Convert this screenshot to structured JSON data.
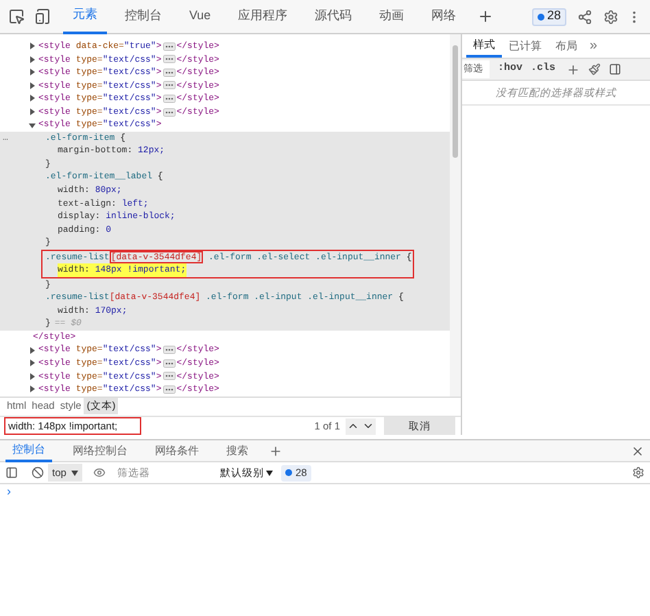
{
  "toolbar": {
    "tabs": [
      {
        "label": "元素",
        "selected": true
      },
      {
        "label": "控制台",
        "selected": false
      },
      {
        "label": "Vue",
        "selected": false
      },
      {
        "label": "应用程序",
        "selected": false
      },
      {
        "label": "源代码",
        "selected": false
      },
      {
        "label": "动画",
        "selected": false
      },
      {
        "label": "网络",
        "selected": false
      }
    ],
    "issues_badge": "28"
  },
  "elements": [
    {
      "expanded": false,
      "tag_open": "<style",
      "attr": "data-cke=",
      "value": "\"true\"",
      "tag_end": ">",
      "close": "</style>"
    },
    {
      "expanded": false,
      "tag_open": "<style",
      "attr": "type=",
      "value": "\"text/css\"",
      "tag_end": ">",
      "close": "</style>"
    },
    {
      "expanded": false,
      "tag_open": "<style",
      "attr": "type=",
      "value": "\"text/css\"",
      "tag_end": ">",
      "close": "</style>"
    },
    {
      "expanded": false,
      "tag_open": "<style",
      "attr": "type=",
      "value": "\"text/css\"",
      "tag_end": ">",
      "close": "</style>"
    },
    {
      "expanded": false,
      "tag_open": "<style",
      "attr": "type=",
      "value": "\"text/css\"",
      "tag_end": ">",
      "close": "</style>"
    },
    {
      "expanded": false,
      "tag_open": "<style",
      "attr": "type=",
      "value": "\"text/css\"",
      "tag_end": ">",
      "close": "</style>"
    },
    {
      "expanded": true,
      "tag_open": "<style",
      "attr": "type=",
      "value": "\"text/css\"",
      "tag_end": ">",
      "close": "</style>",
      "children": [
        {
          "selected": true,
          "marker": "…",
          "rules": [
            {
              "boxed": false,
              "selector": [
                {
                  "text": ".el-form-item",
                  "boxed": false,
                  "kind": "class"
                }
              ],
              "open": "{",
              "close": "}",
              "declarations": [
                {
                  "prop": "margin-bottom:",
                  "value": "12px;",
                  "highlighted": false
                }
              ]
            },
            {
              "boxed": false,
              "selector": [
                {
                  "text": ".el-form-item__label",
                  "boxed": false,
                  "kind": "class"
                }
              ],
              "open": "{",
              "close": "}",
              "declarations": [
                {
                  "prop": "width:",
                  "value": "80px;",
                  "highlighted": false
                },
                {
                  "prop": "text-align:",
                  "value": "left;",
                  "highlighted": false
                },
                {
                  "prop": "display:",
                  "value": "inline-block;",
                  "highlighted": false
                },
                {
                  "prop": "padding:",
                  "value": "0",
                  "highlighted": false
                }
              ]
            },
            {
              "boxed": true,
              "selector": [
                {
                  "text": ".resume-list",
                  "boxed": false,
                  "kind": "class"
                },
                {
                  "text": "[data-v-3544dfe4]",
                  "boxed": true,
                  "kind": "attr"
                },
                {
                  "text": " .el-form .el-select .el-input__inner",
                  "boxed": false,
                  "kind": "class"
                }
              ],
              "open": "{",
              "close": "}",
              "declarations": [
                {
                  "prop": "width:",
                  "value": "148px !important;",
                  "highlighted": true
                }
              ]
            },
            {
              "boxed": false,
              "selector": [
                {
                  "text": ".resume-list",
                  "boxed": false,
                  "kind": "class"
                },
                {
                  "text": "[data-v-3544dfe4]",
                  "boxed": false,
                  "kind": "attr"
                },
                {
                  "text": " .el-form .el-input .el-input__inner",
                  "boxed": false,
                  "kind": "class"
                }
              ],
              "open": "{",
              "close": "}",
              "suffix": "== $0",
              "declarations": [
                {
                  "prop": "width:",
                  "value": "170px;",
                  "highlighted": false
                }
              ]
            }
          ]
        }
      ]
    },
    {
      "expanded": false,
      "tag_open": "<style",
      "attr": "type=",
      "value": "\"text/css\"",
      "tag_end": ">",
      "close": "</style>"
    },
    {
      "expanded": false,
      "tag_open": "<style",
      "attr": "type=",
      "value": "\"text/css\"",
      "tag_end": ">",
      "close": "</style>"
    },
    {
      "expanded": false,
      "tag_open": "<style",
      "attr": "type=",
      "value": "\"text/css\"",
      "tag_end": ">",
      "close": "</style>"
    },
    {
      "expanded": false,
      "tag_open": "<style",
      "attr": "type=",
      "value": "\"text/css\"",
      "tag_end": ">",
      "close": "</style>"
    }
  ],
  "breadcrumbs": [
    {
      "label": "html",
      "selected": false
    },
    {
      "label": "head",
      "selected": false
    },
    {
      "label": "style",
      "selected": false
    },
    {
      "label": "(文本)",
      "selected": true
    }
  ],
  "search": {
    "value": "width: 148px !important;",
    "boxed": true,
    "count": "1 of 1",
    "cancel": "取消"
  },
  "styles_pane": {
    "tabs": [
      {
        "label": "样式",
        "selected": true
      },
      {
        "label": "已计算",
        "selected": false
      },
      {
        "label": "布局",
        "selected": false
      }
    ],
    "more": "»",
    "filter_placeholder": "筛选",
    "hov": ":hov",
    "cls": ".cls",
    "empty_message": "没有匹配的选择器或样式"
  },
  "drawer": {
    "tabs": [
      {
        "label": "控制台",
        "selected": true
      },
      {
        "label": "网络控制台",
        "selected": false
      },
      {
        "label": "网络条件",
        "selected": false
      },
      {
        "label": "搜索",
        "selected": false
      }
    ],
    "context": "top",
    "filter_placeholder": "筛选器",
    "level": "默认级别",
    "issues_badge": "28",
    "prompt": "›"
  }
}
